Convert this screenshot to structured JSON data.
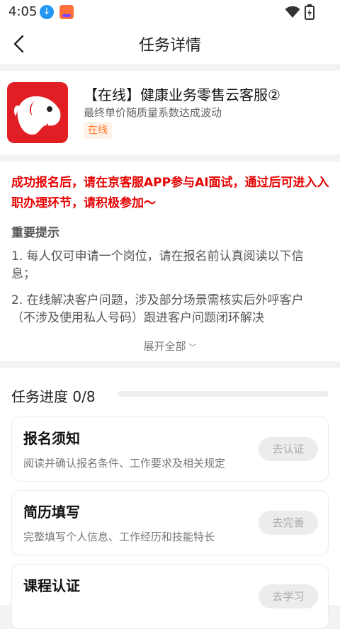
{
  "status_bar": {
    "time": "4:05"
  },
  "header": {
    "title": "任务详情"
  },
  "app": {
    "title": "【在线】健康业务零售云客服②",
    "subtitle": "最终单价随质量系数达成波动",
    "badge": "在线"
  },
  "notice": {
    "red_text": "成功报名后，请在京客服APP参与AI面试，通过后可进入入职办理环节，请积极参加～",
    "heading": "重要提示",
    "items": [
      "1. 每人仅可申请一个岗位，请在报名前认真阅读以下信息；",
      "2. 在线解决客户问题，涉及部分场景需核实后外呼客户（不涉及使用私人号码）跟进客户问题闭环解决"
    ],
    "expand_label": "展开全部"
  },
  "progress": {
    "title": "任务进度 0/8",
    "value": 0,
    "accent": "#ff6f3c"
  },
  "tasks": [
    {
      "name": "报名须知",
      "desc": "阅读并确认报名条件、工作要求及相关规定",
      "button": "去认证"
    },
    {
      "name": "简历填写",
      "desc": "完整填写个人信息、工作经历和技能特长",
      "button": "去完善"
    },
    {
      "name": "课程认证",
      "desc": "",
      "button": "去学习"
    }
  ],
  "colors": {
    "brand_red": "#e21e25",
    "notice_red": "#e80000",
    "badge_orange": "#ff7a28"
  },
  "icons": [
    "download-icon",
    "app-notification-icon",
    "wifi-icon",
    "battery-icon",
    "back-arrow-icon",
    "jd-dog-logo",
    "chevron-down-icon"
  ]
}
